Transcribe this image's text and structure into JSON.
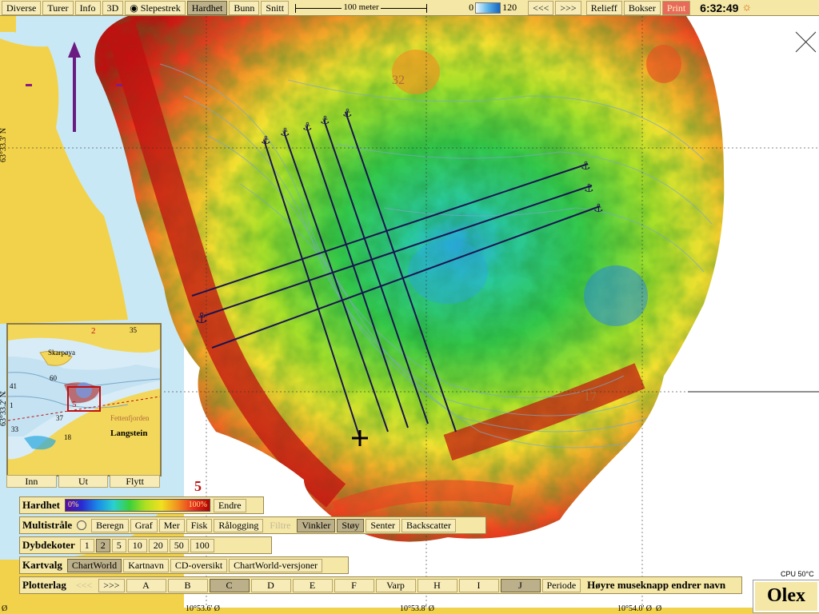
{
  "toolbar": {
    "diverse": "Diverse",
    "turer": "Turer",
    "info": "Info",
    "threed": "3D",
    "slepestrek": "Slepestrek",
    "hardhet": "Hardhet",
    "bunn": "Bunn",
    "snitt": "Snitt",
    "scale_label": "100 meter",
    "depth_min": "0",
    "depth_max": "120",
    "prev": "<<<",
    "next": ">>>",
    "relieff": "Relieff",
    "bokser": "Bokser",
    "print": "Print",
    "clock": "6:32:49"
  },
  "map": {
    "lat_top": "63°33.3' N",
    "lat_bottom": "63°33.2' N",
    "lon_1": "10°53.6' Ø",
    "lon_2": "10°53.8' Ø",
    "lon_3": "10°54.0' Ø",
    "lon_left": "Ø",
    "lon_right": "Ø",
    "depth_label_1": "32",
    "depth_label_2": "17",
    "marker_5": "5"
  },
  "inset": {
    "place_1": "Skarpøya",
    "place_2": "Fettenfjorden",
    "place_3": "Langstein",
    "num_1": "35",
    "num_2": "60",
    "num_3": "41",
    "num_4": "33",
    "num_5": "18",
    "num_6": "5",
    "num_7": "2",
    "num_8": "1",
    "num_9": "37",
    "inn": "Inn",
    "ut": "Ut",
    "flytt": "Flytt"
  },
  "hardhet_row": {
    "label": "Hardhet",
    "min": "0%",
    "max": "100%",
    "endre": "Endre"
  },
  "multistraale_row": {
    "label": "Multistråle",
    "buttons": [
      "Beregn",
      "Graf",
      "Mer",
      "Fisk",
      "Rålogging",
      "Filtre",
      "Vinkler",
      "Støy",
      "Senter",
      "Backscatter"
    ]
  },
  "dybdekoter_row": {
    "label": "Dybdekoter",
    "buttons": [
      "1",
      "2",
      "5",
      "10",
      "20",
      "50",
      "100"
    ]
  },
  "kartvalg_row": {
    "label": "Kartvalg",
    "buttons": [
      "ChartWorld",
      "Kartnavn",
      "CD-oversikt",
      "ChartWorld-versjoner"
    ]
  },
  "plotterlag_row": {
    "label": "Plotterlag",
    "prev": "<<<",
    "next": ">>>",
    "layers": [
      "A",
      "B",
      "C",
      "D",
      "E",
      "F",
      "Varp",
      "H",
      "I",
      "J",
      "Periode"
    ],
    "hint": "Høyre museknapp endrer navn"
  },
  "status": {
    "cpu": "CPU 50°C",
    "logo": "Olex"
  },
  "colors": {
    "panel": "#f5e7a6",
    "land": "#f2d24a",
    "water": "#cde9f4",
    "active": "#bcb08a",
    "print": "#e86a5a"
  }
}
